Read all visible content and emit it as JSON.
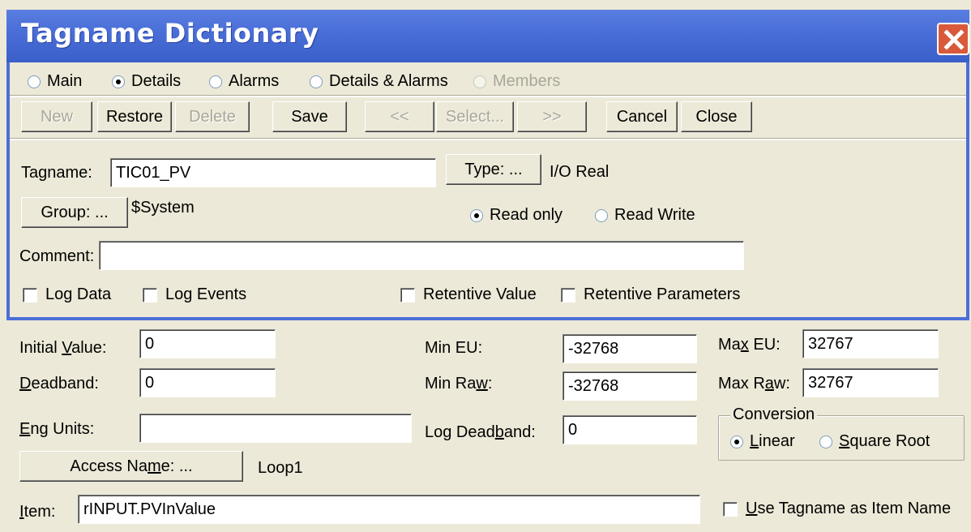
{
  "window": {
    "title": "Tagname Dictionary"
  },
  "view_radios": [
    {
      "label": "Main",
      "checked": false,
      "enabled": true
    },
    {
      "label": "Details",
      "checked": true,
      "enabled": true
    },
    {
      "label": "Alarms",
      "checked": false,
      "enabled": true
    },
    {
      "label": "Details & Alarms",
      "checked": false,
      "enabled": true
    },
    {
      "label": "Members",
      "checked": false,
      "enabled": false
    }
  ],
  "toolbar": {
    "new": "New",
    "restore": "Restore",
    "delete": "Delete",
    "save": "Save",
    "prev": "<<",
    "select": "Select...",
    "next": ">>",
    "cancel": "Cancel",
    "close": "Close"
  },
  "tag": {
    "tagname_label": "Tagname:",
    "tagname_value": "TIC01_PV",
    "type_button": "Type: ...",
    "type_value": "I/O Real",
    "group_button": "Group: ...",
    "group_value": "$System",
    "read_only": "Read only",
    "read_write": "Read Write",
    "comment_label": "Comment:",
    "comment_value": "",
    "log_data": "Log Data",
    "log_events": "Log Events",
    "retentive_value": "Retentive Value",
    "retentive_parameters": "Retentive Parameters"
  },
  "details": {
    "initial_value_label": "Initial Value:",
    "initial_value": "0",
    "deadband_label": "Deadband:",
    "deadband": "0",
    "eng_units_label": "Eng Units:",
    "eng_units": "",
    "min_eu_label": "Min EU:",
    "min_eu": "-32768",
    "min_raw_label": "Min Raw:",
    "min_raw": "-32768",
    "log_deadband_label": "Log Deadband:",
    "log_deadband": "0",
    "max_eu_label": "Max EU:",
    "max_eu": "32767",
    "max_raw_label": "Max Raw:",
    "max_raw": "32767",
    "conversion_title": "Conversion",
    "linear": "Linear",
    "square_root": "Square Root",
    "access_name_button": "Access Name: ...",
    "access_name_value": "Loop1",
    "item_label": "Item:",
    "item_value": "rINPUT.PVInValue",
    "use_tagname": "Use Tagname as Item Name"
  }
}
